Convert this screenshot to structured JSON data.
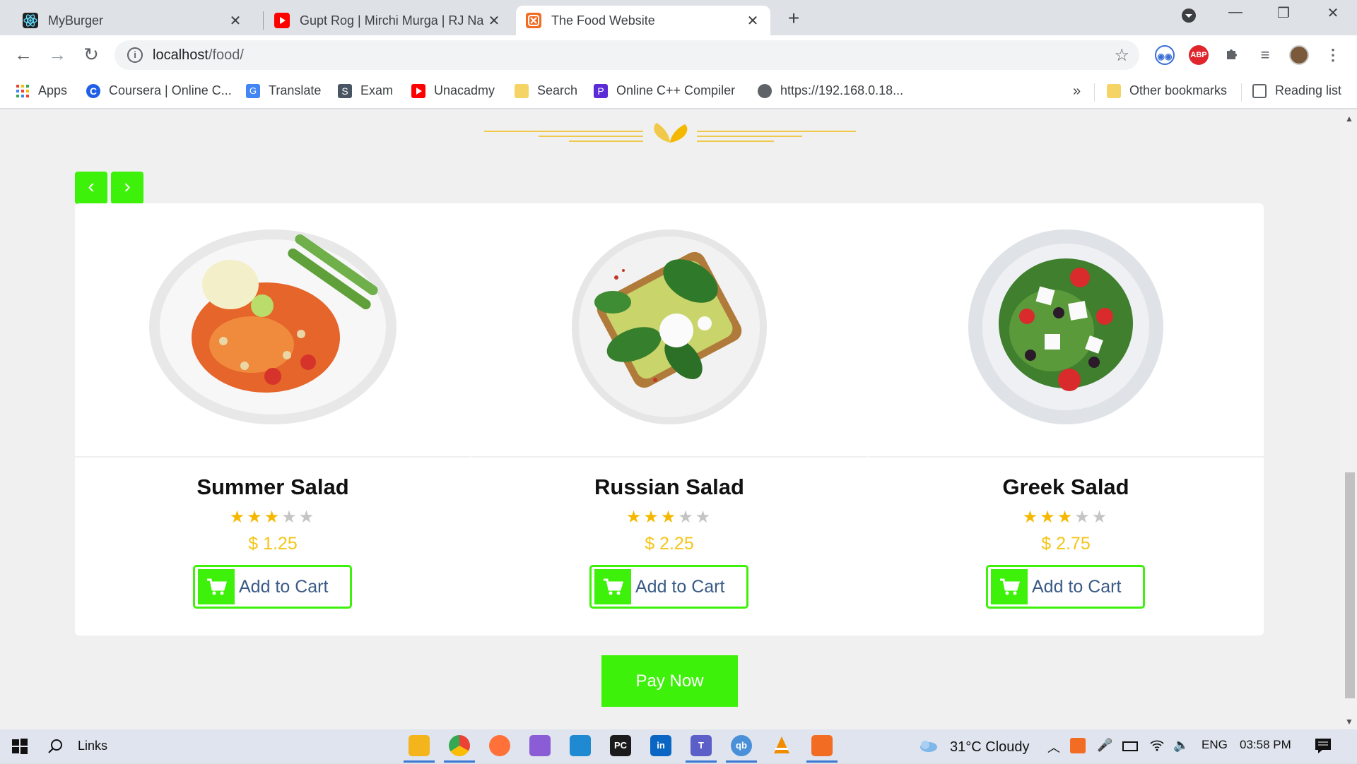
{
  "browser": {
    "tabs": [
      {
        "title": "MyBurger",
        "favicon": "react-icon",
        "active": false
      },
      {
        "title": "Gupt Rog | Mirchi Murga | RJ Na",
        "favicon": "youtube-icon",
        "active": false
      },
      {
        "title": "The Food Website",
        "favicon": "xampp-icon",
        "active": true
      }
    ],
    "url_host": "localhost",
    "url_path": "/food/",
    "bookmarks": [
      {
        "label": "Apps",
        "icon": "apps-grid-icon"
      },
      {
        "label": "Coursera | Online C...",
        "icon": "coursera-icon"
      },
      {
        "label": "Translate",
        "icon": "translate-icon"
      },
      {
        "label": "Exam",
        "icon": "exam-icon"
      },
      {
        "label": "Unacadmy",
        "icon": "youtube-icon"
      },
      {
        "label": "Search",
        "icon": "folder-icon"
      },
      {
        "label": "Online C++ Compiler",
        "icon": "compiler-icon"
      },
      {
        "label": "https://192.168.0.18...",
        "icon": "globe-icon"
      }
    ],
    "overflow": "»",
    "other_bookmarks": "Other bookmarks",
    "reading_list": "Reading list",
    "extensions": [
      {
        "name": "owl-extension-icon",
        "text": "",
        "color": "#3b6fd6"
      },
      {
        "name": "adblock-plus-icon",
        "text": "ABP",
        "color": "#e0262d"
      },
      {
        "name": "puzzle-extensions-icon",
        "text": "",
        "color": "#5f6368"
      },
      {
        "name": "media-queue-icon",
        "text": "",
        "color": "#5f6368"
      }
    ]
  },
  "page": {
    "accent": "#3ef10a",
    "price_color": "#f5c518",
    "star_color": "#f5b800",
    "products": [
      {
        "name": "Summer Salad",
        "rating": 3,
        "max_rating": 5,
        "price": "$ 1.25",
        "button": "Add to Cart"
      },
      {
        "name": "Russian Salad",
        "rating": 3,
        "max_rating": 5,
        "price": "$ 2.25",
        "button": "Add to Cart"
      },
      {
        "name": "Greek Salad",
        "rating": 3,
        "max_rating": 5,
        "price": "$ 2.75",
        "button": "Add to Cart"
      }
    ],
    "pay_now": "Pay Now"
  },
  "taskbar": {
    "search_label": "Links",
    "apps": [
      {
        "name": "file-explorer-icon",
        "color": "#f3b51b",
        "text": "",
        "open": true
      },
      {
        "name": "chrome-icon",
        "color": "#ffffff",
        "text": "",
        "open": true
      },
      {
        "name": "firefox-icon",
        "color": "#ff7139",
        "text": "",
        "open": false
      },
      {
        "name": "visual-studio-icon",
        "color": "#8a5cd6",
        "text": "",
        "open": false
      },
      {
        "name": "vscode-icon",
        "color": "#1f8ad2",
        "text": "",
        "open": false
      },
      {
        "name": "pycharm-icon",
        "color": "#1b1b1b",
        "text": "PC",
        "open": false
      },
      {
        "name": "linkedin-icon",
        "color": "#0a66c2",
        "text": "in",
        "open": false
      },
      {
        "name": "teams-icon",
        "color": "#5b5fc7",
        "text": "T",
        "open": true
      },
      {
        "name": "qbittorrent-icon",
        "color": "#4a90d9",
        "text": "qb",
        "open": true
      },
      {
        "name": "vlc-icon",
        "color": "#f08c00",
        "text": "",
        "open": false
      },
      {
        "name": "xampp-icon",
        "color": "#f26c23",
        "text": "",
        "open": true
      }
    ],
    "weather": "31°C  Cloudy",
    "language": "ENG",
    "time": "03:58 PM"
  }
}
